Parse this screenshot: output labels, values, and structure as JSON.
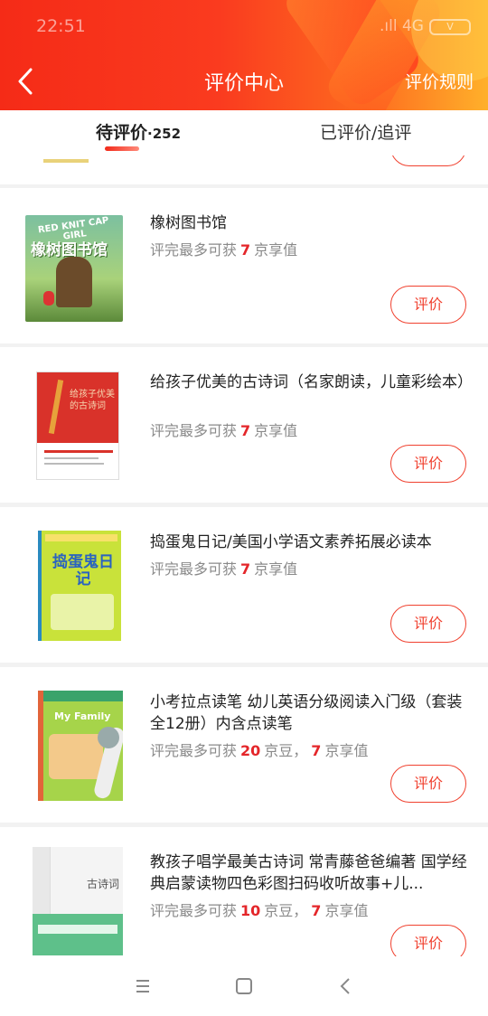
{
  "status_bar": {
    "time": "22:51",
    "network": "4G",
    "battery": "V"
  },
  "header": {
    "title": "评价中心",
    "rules_label": "评价规则"
  },
  "tabs": {
    "pending_label": "待评价",
    "pending_separator": "·",
    "pending_count": "252",
    "done_label": "已评价/追评"
  },
  "accent_color": "#f0412f",
  "items": [
    {
      "title": "橡树图书馆",
      "reward_prefix": "评完最多可获",
      "beans": "",
      "beans_unit": "",
      "jd_value": "7",
      "jd_unit": "京享值",
      "button": "评价",
      "cover_text": "橡树图书馆",
      "cover_caption": "RED KNIT CAP GIRL"
    },
    {
      "title": "给孩子优美的古诗词（名家朗读，儿童彩绘本）",
      "reward_prefix": "评完最多可获",
      "beans": "",
      "beans_unit": "",
      "jd_value": "7",
      "jd_unit": "京享值",
      "button": "评价",
      "cover_text": "给孩子优美的古诗词"
    },
    {
      "title": "捣蛋鬼日记/美国小学语文素养拓展必读本",
      "reward_prefix": "评完最多可获",
      "beans": "",
      "beans_unit": "",
      "jd_value": "7",
      "jd_unit": "京享值",
      "button": "评价",
      "cover_text": "捣蛋鬼日记"
    },
    {
      "title": "小考拉点读笔 幼儿英语分级阅读入门级（套装全12册）内含点读笔",
      "reward_prefix": "评完最多可获",
      "beans": "20",
      "beans_unit": "京豆，",
      "jd_value": "7",
      "jd_unit": "京享值",
      "button": "评价",
      "cover_text": "My Family"
    },
    {
      "title": "教孩子唱学最美古诗词 常青藤爸爸编著 国学经典启蒙读物四色彩图扫码收听故事+儿...",
      "reward_prefix": "评完最多可获",
      "beans": "10",
      "beans_unit": "京豆，",
      "jd_value": "7",
      "jd_unit": "京享值",
      "button": "评价",
      "cover_text": "古诗词"
    }
  ]
}
